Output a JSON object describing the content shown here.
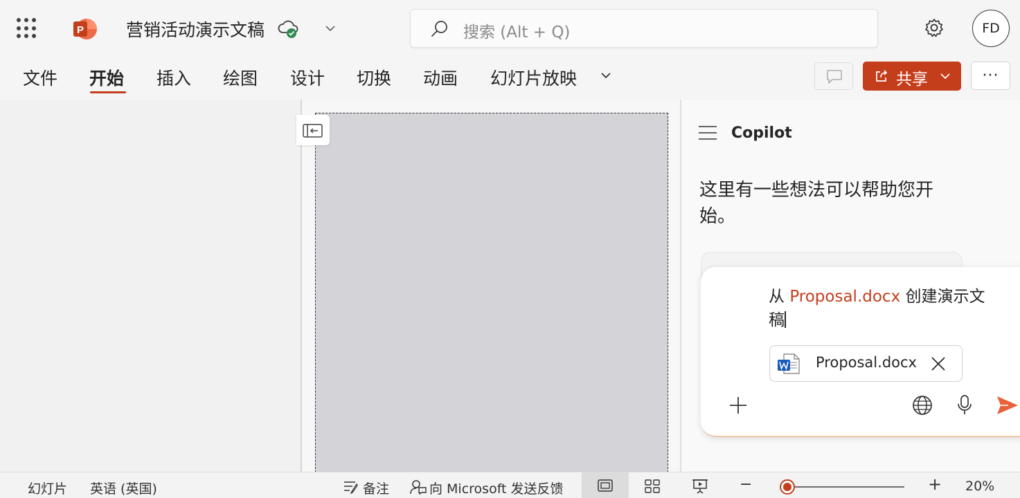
{
  "app": {
    "document_title": "营销活动演示文稿",
    "logo_letter": "P",
    "accent_color": "#c43e1c"
  },
  "search": {
    "placeholder": "搜索 (Alt + Q)"
  },
  "user": {
    "initials": "FD"
  },
  "ribbon": {
    "tabs": [
      {
        "label": "文件"
      },
      {
        "label": "开始",
        "active": true
      },
      {
        "label": "插入"
      },
      {
        "label": "绘图"
      },
      {
        "label": "设计"
      },
      {
        "label": "切换"
      },
      {
        "label": "动画"
      },
      {
        "label": "幻灯片放映"
      }
    ],
    "share_label": "共享",
    "more_label": "···"
  },
  "copilot": {
    "title": "Copilot",
    "heading": "这里有一些想法可以帮助您开始。",
    "prompt_prefix": "从 ",
    "prompt_file": "Proposal.docx",
    "prompt_suffix": " 创建演示文稿",
    "attachment_name": "Proposal.docx"
  },
  "status": {
    "slide_label": "幻灯片",
    "language": "英语 (英国)",
    "notes_label": "备注",
    "feedback_label": "向 Microsoft 发送反馈",
    "zoom_out_label": "−",
    "zoom_in_label": "+",
    "zoom_level": "20%",
    "zoom_fraction": 0.04
  }
}
